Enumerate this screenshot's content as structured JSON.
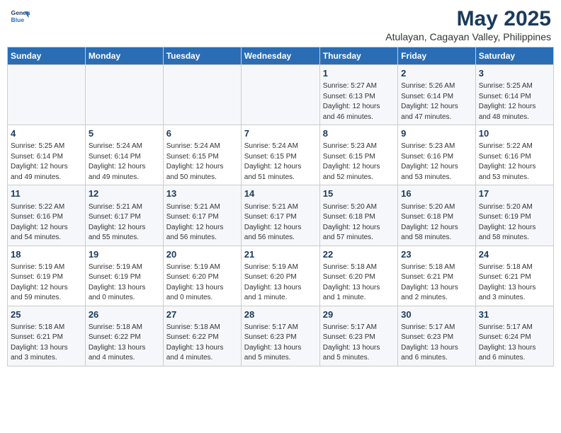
{
  "logo": {
    "line1": "General",
    "line2": "Blue"
  },
  "title": "May 2025",
  "subtitle": "Atulayan, Cagayan Valley, Philippines",
  "headers": [
    "Sunday",
    "Monday",
    "Tuesday",
    "Wednesday",
    "Thursday",
    "Friday",
    "Saturday"
  ],
  "weeks": [
    [
      {
        "day": "",
        "info": ""
      },
      {
        "day": "",
        "info": ""
      },
      {
        "day": "",
        "info": ""
      },
      {
        "day": "",
        "info": ""
      },
      {
        "day": "1",
        "info": "Sunrise: 5:27 AM\nSunset: 6:13 PM\nDaylight: 12 hours\nand 46 minutes."
      },
      {
        "day": "2",
        "info": "Sunrise: 5:26 AM\nSunset: 6:14 PM\nDaylight: 12 hours\nand 47 minutes."
      },
      {
        "day": "3",
        "info": "Sunrise: 5:25 AM\nSunset: 6:14 PM\nDaylight: 12 hours\nand 48 minutes."
      }
    ],
    [
      {
        "day": "4",
        "info": "Sunrise: 5:25 AM\nSunset: 6:14 PM\nDaylight: 12 hours\nand 49 minutes."
      },
      {
        "day": "5",
        "info": "Sunrise: 5:24 AM\nSunset: 6:14 PM\nDaylight: 12 hours\nand 49 minutes."
      },
      {
        "day": "6",
        "info": "Sunrise: 5:24 AM\nSunset: 6:15 PM\nDaylight: 12 hours\nand 50 minutes."
      },
      {
        "day": "7",
        "info": "Sunrise: 5:24 AM\nSunset: 6:15 PM\nDaylight: 12 hours\nand 51 minutes."
      },
      {
        "day": "8",
        "info": "Sunrise: 5:23 AM\nSunset: 6:15 PM\nDaylight: 12 hours\nand 52 minutes."
      },
      {
        "day": "9",
        "info": "Sunrise: 5:23 AM\nSunset: 6:16 PM\nDaylight: 12 hours\nand 53 minutes."
      },
      {
        "day": "10",
        "info": "Sunrise: 5:22 AM\nSunset: 6:16 PM\nDaylight: 12 hours\nand 53 minutes."
      }
    ],
    [
      {
        "day": "11",
        "info": "Sunrise: 5:22 AM\nSunset: 6:16 PM\nDaylight: 12 hours\nand 54 minutes."
      },
      {
        "day": "12",
        "info": "Sunrise: 5:21 AM\nSunset: 6:17 PM\nDaylight: 12 hours\nand 55 minutes."
      },
      {
        "day": "13",
        "info": "Sunrise: 5:21 AM\nSunset: 6:17 PM\nDaylight: 12 hours\nand 56 minutes."
      },
      {
        "day": "14",
        "info": "Sunrise: 5:21 AM\nSunset: 6:17 PM\nDaylight: 12 hours\nand 56 minutes."
      },
      {
        "day": "15",
        "info": "Sunrise: 5:20 AM\nSunset: 6:18 PM\nDaylight: 12 hours\nand 57 minutes."
      },
      {
        "day": "16",
        "info": "Sunrise: 5:20 AM\nSunset: 6:18 PM\nDaylight: 12 hours\nand 58 minutes."
      },
      {
        "day": "17",
        "info": "Sunrise: 5:20 AM\nSunset: 6:19 PM\nDaylight: 12 hours\nand 58 minutes."
      }
    ],
    [
      {
        "day": "18",
        "info": "Sunrise: 5:19 AM\nSunset: 6:19 PM\nDaylight: 12 hours\nand 59 minutes."
      },
      {
        "day": "19",
        "info": "Sunrise: 5:19 AM\nSunset: 6:19 PM\nDaylight: 13 hours\nand 0 minutes."
      },
      {
        "day": "20",
        "info": "Sunrise: 5:19 AM\nSunset: 6:20 PM\nDaylight: 13 hours\nand 0 minutes."
      },
      {
        "day": "21",
        "info": "Sunrise: 5:19 AM\nSunset: 6:20 PM\nDaylight: 13 hours\nand 1 minute."
      },
      {
        "day": "22",
        "info": "Sunrise: 5:18 AM\nSunset: 6:20 PM\nDaylight: 13 hours\nand 1 minute."
      },
      {
        "day": "23",
        "info": "Sunrise: 5:18 AM\nSunset: 6:21 PM\nDaylight: 13 hours\nand 2 minutes."
      },
      {
        "day": "24",
        "info": "Sunrise: 5:18 AM\nSunset: 6:21 PM\nDaylight: 13 hours\nand 3 minutes."
      }
    ],
    [
      {
        "day": "25",
        "info": "Sunrise: 5:18 AM\nSunset: 6:21 PM\nDaylight: 13 hours\nand 3 minutes."
      },
      {
        "day": "26",
        "info": "Sunrise: 5:18 AM\nSunset: 6:22 PM\nDaylight: 13 hours\nand 4 minutes."
      },
      {
        "day": "27",
        "info": "Sunrise: 5:18 AM\nSunset: 6:22 PM\nDaylight: 13 hours\nand 4 minutes."
      },
      {
        "day": "28",
        "info": "Sunrise: 5:17 AM\nSunset: 6:23 PM\nDaylight: 13 hours\nand 5 minutes."
      },
      {
        "day": "29",
        "info": "Sunrise: 5:17 AM\nSunset: 6:23 PM\nDaylight: 13 hours\nand 5 minutes."
      },
      {
        "day": "30",
        "info": "Sunrise: 5:17 AM\nSunset: 6:23 PM\nDaylight: 13 hours\nand 6 minutes."
      },
      {
        "day": "31",
        "info": "Sunrise: 5:17 AM\nSunset: 6:24 PM\nDaylight: 13 hours\nand 6 minutes."
      }
    ]
  ]
}
